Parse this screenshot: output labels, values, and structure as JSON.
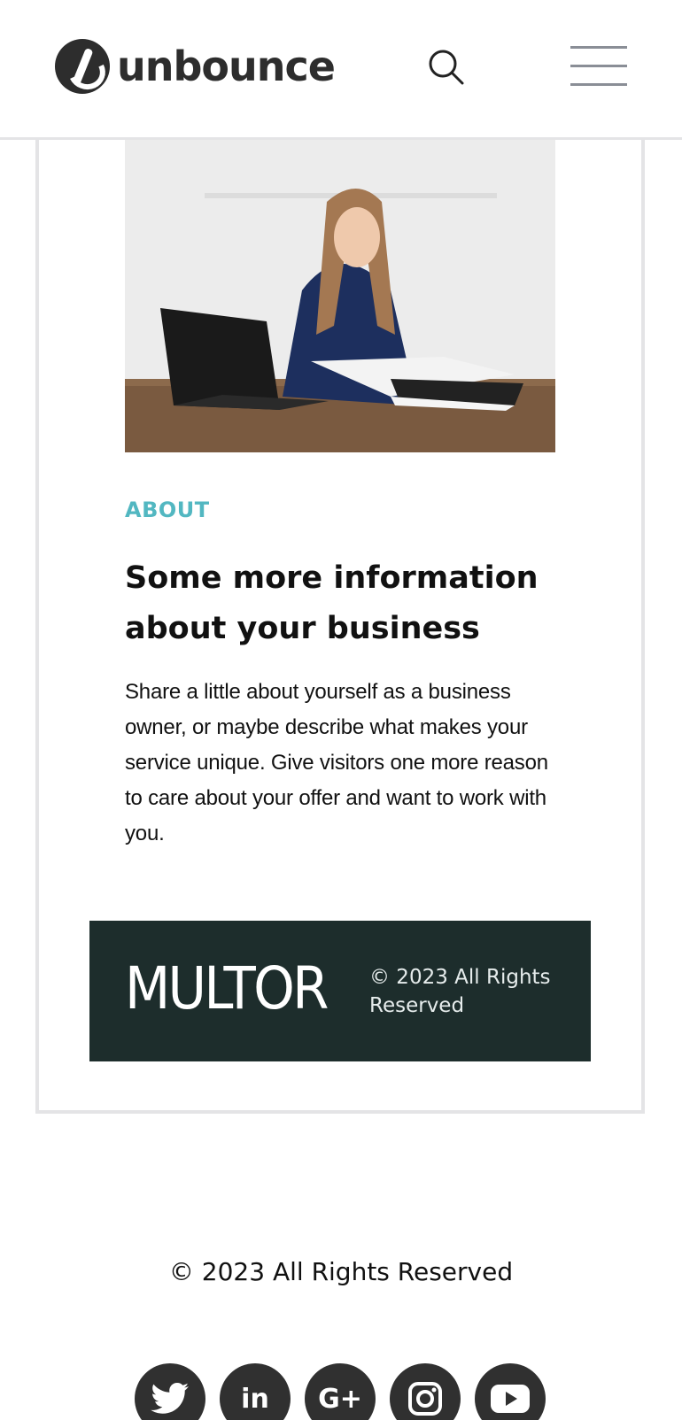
{
  "header": {
    "brand_text": "unbounce",
    "search_icon": "search-icon",
    "menu_icon": "hamburger-menu-icon"
  },
  "about": {
    "image_alt": "Woman smiling at desk with laptop and magazines",
    "eyebrow": "ABOUT",
    "heading_line1": "Some more information",
    "heading_line2": "about your business",
    "body": "Share a little about yourself as a business owner, or maybe describe what makes your service unique. Give visitors one more reason to care about your offer and want to work with you."
  },
  "card_footer": {
    "brand": "MULTOR",
    "copyright_line1": "© 2023 All Rights",
    "copyright_line2": "Reserved",
    "background": "#1d2d2c"
  },
  "page_footer": {
    "copyright": "© 2023 All Rights Reserved"
  },
  "socials": [
    {
      "icon": "twitter-icon",
      "label": ""
    },
    {
      "icon": "linkedin-icon",
      "label": "in"
    },
    {
      "icon": "google-plus-icon",
      "label": "G+"
    },
    {
      "icon": "instagram-icon",
      "label": ""
    },
    {
      "icon": "youtube-icon",
      "label": ""
    }
  ],
  "colors": {
    "accent": "#52b7c1",
    "dark": "#1d2d2c",
    "icon_bg": "#303030"
  }
}
